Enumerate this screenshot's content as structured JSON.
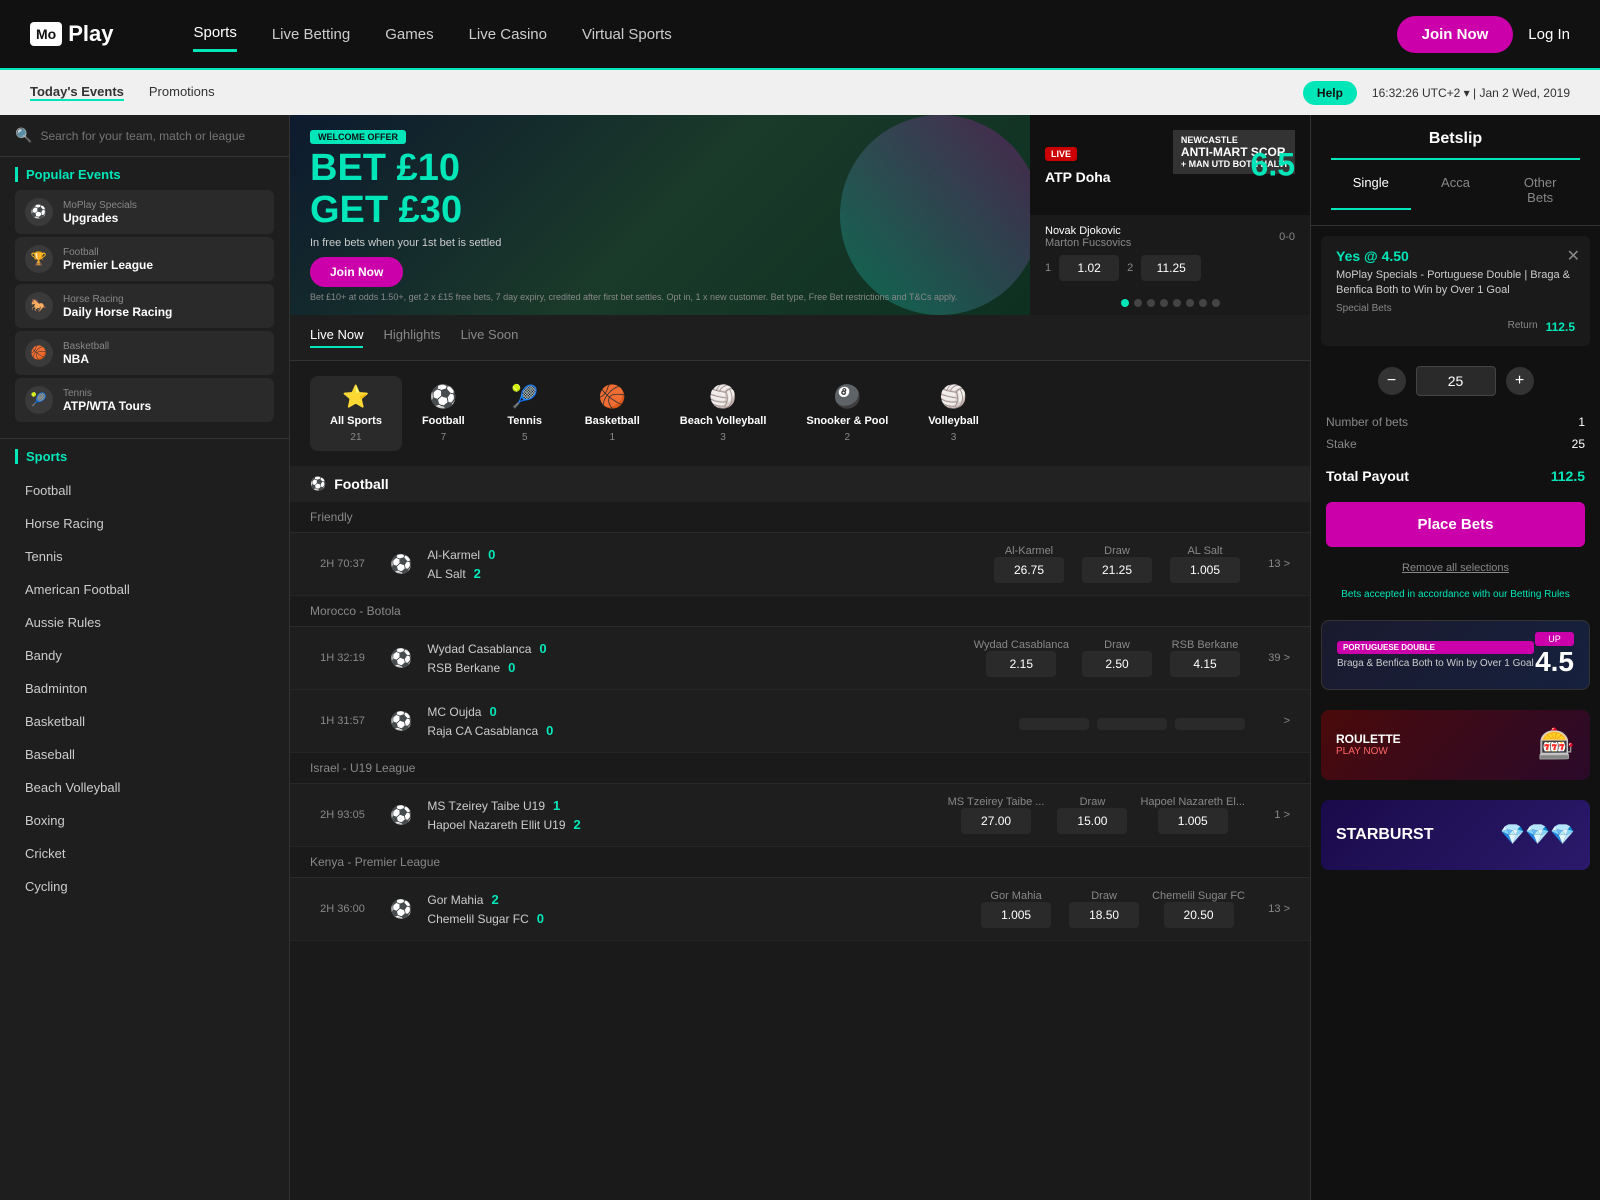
{
  "header": {
    "logo_box": "Mo",
    "logo_text": "Play",
    "nav_items": [
      {
        "label": "Sports",
        "active": true
      },
      {
        "label": "Live Betting",
        "active": false
      },
      {
        "label": "Games",
        "active": false
      },
      {
        "label": "Live Casino",
        "active": false
      },
      {
        "label": "Virtual Sports",
        "active": false
      }
    ],
    "join_label": "Join Now",
    "login_label": "Log In"
  },
  "subheader": {
    "nav_items": [
      {
        "label": "Today's Events",
        "active": true
      },
      {
        "label": "Promotions",
        "active": false
      }
    ],
    "help_label": "Help",
    "time": "16:32:26",
    "timezone": "UTC+2",
    "date": "Jan 2 Wed, 2019"
  },
  "sidebar": {
    "search_placeholder": "Search for your team, match or league",
    "popular_title": "Popular Events",
    "popular_items": [
      {
        "icon": "⚽",
        "cat": "MoPlay Specials",
        "name": "Upgrades"
      },
      {
        "icon": "🏆",
        "cat": "Football",
        "name": "Premier League"
      },
      {
        "icon": "🐎",
        "cat": "Horse Racing",
        "name": "Daily Horse Racing"
      },
      {
        "icon": "🏀",
        "cat": "Basketball",
        "name": "NBA"
      },
      {
        "icon": "🎾",
        "cat": "Tennis",
        "name": "ATP/WTA Tours"
      }
    ],
    "sports_title": "Sports",
    "sports_items": [
      "Football",
      "Horse Racing",
      "Tennis",
      "American Football",
      "Aussie Rules",
      "Bandy",
      "Badminton",
      "Basketball",
      "Baseball",
      "Beach Volleyball",
      "Boxing",
      "Cricket",
      "Cycling"
    ]
  },
  "banner": {
    "welcome_label": "WELCOME OFFER",
    "bet_amount": "BET £10",
    "get_amount": "GET £30",
    "in_label": "In free bets",
    "when_label": "when your 1st bet is settled",
    "join_label": "Join Now",
    "terms": "Bet £10+ at odds 1.50+, get 2 x £15 free bets, 7 day expiry, credited after first bet settles. Opt in, 1 x new customer. Bet type, Free Bet restrictions and T&Cs apply.",
    "side_match": "ATP Doha",
    "live_label": "LIVE",
    "side_odds": "6.5",
    "player1": "Novak Djokovic",
    "player2": "Marton Fucsovics",
    "score": "0-0",
    "set1": "1",
    "odds1": "1.02",
    "set2": "2",
    "odds2": "11.25",
    "newcastle_label": "NEWCASTLE",
    "anti_label": "ANTI-MART SCOR",
    "man_utd": "+ MAN UTD BOTH HALVI"
  },
  "live_tabs": [
    {
      "label": "Live Now",
      "active": true
    },
    {
      "label": "Highlights",
      "active": false
    },
    {
      "label": "Live Soon",
      "active": false
    }
  ],
  "sport_filters": [
    {
      "icon": "⚽",
      "name": "All Sports",
      "count": "21",
      "active": true
    },
    {
      "icon": "⚽",
      "name": "Football",
      "count": "7",
      "active": false
    },
    {
      "icon": "🎾",
      "name": "Tennis",
      "count": "5",
      "active": false
    },
    {
      "icon": "🏀",
      "name": "Basketball",
      "count": "1",
      "active": false
    },
    {
      "icon": "🏐",
      "name": "Beach Volleyball",
      "count": "3",
      "active": false
    },
    {
      "icon": "🎱",
      "name": "Snooker & Pool",
      "count": "2",
      "active": false
    },
    {
      "icon": "🏐",
      "name": "Volleyball",
      "count": "3",
      "active": false
    }
  ],
  "football_section": {
    "title": "Football",
    "leagues": [
      {
        "name": "Friendly",
        "matches": [
          {
            "time": "2H 70:37",
            "team1": "Al-Karmel",
            "score1": "0",
            "team2": "AL Salt",
            "score2": "2",
            "odds_home": "26.75",
            "odds_home_label": "Al-Karmel",
            "odds_draw": "21.25",
            "odds_draw_label": "Draw",
            "odds_away": "1.005",
            "odds_away_label": "AL Salt",
            "more": "13 >"
          }
        ]
      },
      {
        "name": "Morocco - Botola",
        "matches": [
          {
            "time": "1H 32:19",
            "team1": "Wydad Casablanca",
            "score1": "0",
            "team2": "RSB Berkane",
            "score2": "0",
            "odds_home": "2.15",
            "odds_home_label": "Wydad Casablanca",
            "odds_draw": "2.50",
            "odds_draw_label": "Draw",
            "odds_away": "4.15",
            "odds_away_label": "RSB Berkane",
            "more": "39 >"
          },
          {
            "time": "1H 31:57",
            "team1": "MC Oujda",
            "score1": "0",
            "team2": "Raja CA Casablanca",
            "score2": "0",
            "odds_home": "",
            "odds_home_label": "",
            "odds_draw": "",
            "odds_draw_label": "",
            "odds_away": "",
            "odds_away_label": "",
            "more": ">"
          }
        ]
      },
      {
        "name": "Israel - U19 League",
        "matches": [
          {
            "time": "2H 93:05",
            "team1": "MS Tzeirey Taibe U19",
            "score1": "1",
            "team2": "Hapoel Nazareth Ellit U19",
            "score2": "2",
            "odds_home": "27.00",
            "odds_home_label": "MS Tzeirey Taibe ...",
            "odds_draw": "15.00",
            "odds_draw_label": "Draw",
            "odds_away": "1.005",
            "odds_away_label": "Hapoel Nazareth El...",
            "more": "1 >"
          }
        ]
      },
      {
        "name": "Kenya - Premier League",
        "matches": [
          {
            "time": "2H 36:00",
            "team1": "Gor Mahia",
            "score1": "2",
            "team2": "Chemelil Sugar FC",
            "score2": "0",
            "odds_home": "1.005",
            "odds_home_label": "Gor Mahia",
            "odds_draw": "18.50",
            "odds_draw_label": "Draw",
            "odds_away": "20.50",
            "odds_away_label": "Chemelil Sugar FC",
            "more": "13 >"
          }
        ]
      }
    ]
  },
  "betslip": {
    "title": "Betslip",
    "tabs": [
      {
        "label": "Single",
        "active": true
      },
      {
        "label": "Acca",
        "active": false
      },
      {
        "label": "Other Bets",
        "active": false
      }
    ],
    "bet_odds": "Yes @ 4.50",
    "bet_desc": "MoPlay Specials - Portuguese Double | Braga & Benfica Both to Win by Over 1 Goal",
    "bet_type": "Special Bets",
    "stake": "25",
    "return_label": "Return",
    "return_value": "112.5",
    "number_of_bets_label": "Number of bets",
    "number_of_bets": "1",
    "stake_label": "Stake",
    "stake_value": "25",
    "total_payout_label": "Total Payout",
    "total_payout": "112.5",
    "place_bets_label": "Place Bets",
    "remove_all_label": "Remove all selections",
    "rules_text": "Bets accepted in accordance with our Betting Rules",
    "promo1_badge": "PORTUGUESE DOUBLE",
    "promo1_text": "Braga & Benfica Both to Win by Over 1 Goal",
    "promo1_odds": "4.5",
    "promo1_label": "UP",
    "promo2_text": "ROULETTE",
    "promo2_sub": "PLAY NOW",
    "promo3_text": "STARBURST"
  },
  "dots": [
    "active",
    "",
    "",
    "",
    "",
    "",
    "",
    "",
    ""
  ]
}
